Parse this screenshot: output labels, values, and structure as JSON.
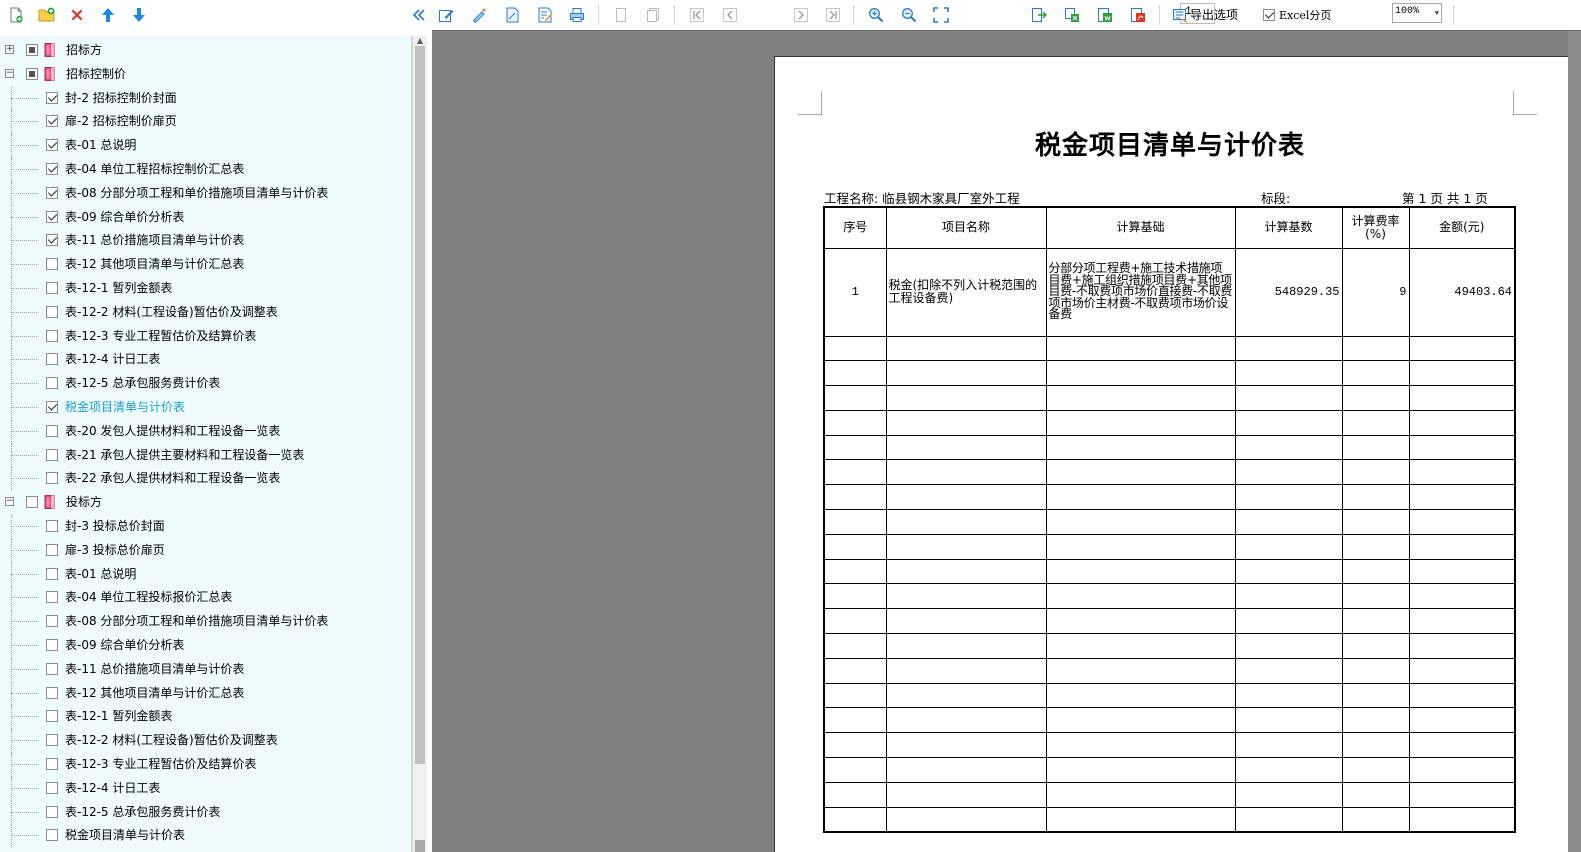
{
  "tree": {
    "nodes": [
      {
        "label": "招标方",
        "level": 0,
        "expanded": false,
        "check": "partial"
      },
      {
        "label": "招标控制价",
        "level": 0,
        "expanded": true,
        "check": "partial"
      },
      {
        "label": "封-2 招标控制价封面",
        "level": 1,
        "check": "checked"
      },
      {
        "label": "扉-2 招标控制价扉页",
        "level": 1,
        "check": "checked"
      },
      {
        "label": "表-01 总说明",
        "level": 1,
        "check": "checked"
      },
      {
        "label": "表-04 单位工程招标控制价汇总表",
        "level": 1,
        "check": "checked"
      },
      {
        "label": "表-08 分部分项工程和单价措施项目清单与计价表",
        "level": 1,
        "check": "checked"
      },
      {
        "label": "表-09 综合单价分析表",
        "level": 1,
        "check": "checked"
      },
      {
        "label": "表-11 总价措施项目清单与计价表",
        "level": 1,
        "check": "checked"
      },
      {
        "label": "表-12 其他项目清单与计价汇总表",
        "level": 1,
        "check": "none"
      },
      {
        "label": "表-12-1 暂列金额表",
        "level": 1,
        "check": "none"
      },
      {
        "label": "表-12-2 材料(工程设备)暂估价及调整表",
        "level": 1,
        "check": "none"
      },
      {
        "label": "表-12-3 专业工程暂估价及结算价表",
        "level": 1,
        "check": "none"
      },
      {
        "label": "表-12-4 计日工表",
        "level": 1,
        "check": "none"
      },
      {
        "label": "表-12-5 总承包服务费计价表",
        "level": 1,
        "check": "none"
      },
      {
        "label": "税金项目清单与计价表",
        "level": 1,
        "check": "checked",
        "selected": true
      },
      {
        "label": "表-20 发包人提供材料和工程设备一览表",
        "level": 1,
        "check": "none"
      },
      {
        "label": "表-21 承包人提供主要材料和工程设备一览表",
        "level": 1,
        "check": "none"
      },
      {
        "label": "表-22 承包人提供材料和工程设备一览表",
        "level": 1,
        "check": "none"
      },
      {
        "label": "投标方",
        "level": 0,
        "expanded": true,
        "check": "none"
      },
      {
        "label": "封-3 投标总价封面",
        "level": 1,
        "check": "none"
      },
      {
        "label": "扉-3 投标总价扉页",
        "level": 1,
        "check": "none"
      },
      {
        "label": "表-01 总说明",
        "level": 1,
        "check": "none"
      },
      {
        "label": "表-04 单位工程投标报价汇总表",
        "level": 1,
        "check": "none"
      },
      {
        "label": "表-08 分部分项工程和单价措施项目清单与计价表",
        "level": 1,
        "check": "none"
      },
      {
        "label": "表-09 综合单价分析表",
        "level": 1,
        "check": "none"
      },
      {
        "label": "表-11 总价措施项目清单与计价表",
        "level": 1,
        "check": "none"
      },
      {
        "label": "表-12 其他项目清单与计价汇总表",
        "level": 1,
        "check": "none"
      },
      {
        "label": "表-12-1 暂列金额表",
        "level": 1,
        "check": "none"
      },
      {
        "label": "表-12-2 材料(工程设备)暂估价及调整表",
        "level": 1,
        "check": "none"
      },
      {
        "label": "表-12-3 专业工程暂估价及结算价表",
        "level": 1,
        "check": "none"
      },
      {
        "label": "表-12-4 计日工表",
        "level": 1,
        "check": "none"
      },
      {
        "label": "表-12-5 总承包服务费计价表",
        "level": 1,
        "check": "none"
      },
      {
        "label": "税金项目清单与计价表",
        "level": 1,
        "check": "none"
      }
    ]
  },
  "left_toolbar": {
    "icons": [
      "new-report-icon",
      "new-folder-icon",
      "delete-icon",
      "move-up-icon",
      "move-down-icon",
      "collapse-panel-icon"
    ]
  },
  "toolbar": {
    "page_number": "1",
    "zoom": "100%",
    "export_options_label": "导出选项",
    "excel_paging_label": "Excel分页",
    "excel_paging_checked": true
  },
  "report": {
    "title": "税金项目清单与计价表",
    "project_label": "工程名称: 临县钢木家具厂室外工程",
    "section_label": "标段:",
    "page_info": "第 1 页  共 1 页",
    "columns": [
      "序号",
      "项目名称",
      "计算基础",
      "计算基数",
      "计算费率\n(%)",
      "金额(元)"
    ],
    "rows": [
      {
        "seq": "1",
        "name": "税金(扣除不列入计税范围的工程设备费)",
        "basis": "分部分项工程费+施工技术措施项目费+施工组织措施项目费+其他项目费-不取费项市场价直接费-不取费项市场价主材费-不取费项市场价设备费",
        "base_amount": "548929.35",
        "rate": "9",
        "amount": "49403.64"
      }
    ],
    "empty_rows": 20
  }
}
